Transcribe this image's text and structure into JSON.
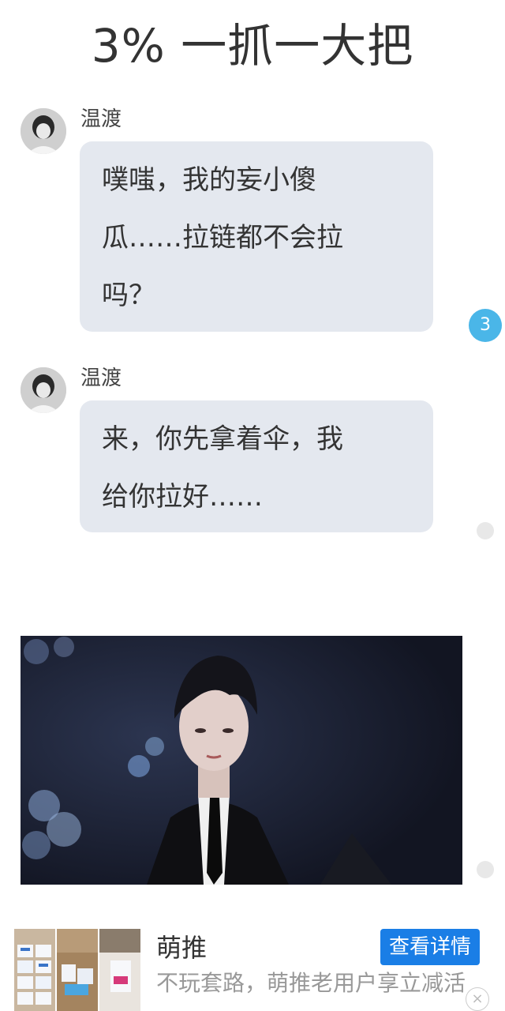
{
  "header": {
    "title": "3% 一抓一大把"
  },
  "messages": [
    {
      "sender": "温渡",
      "text": "噗嗤，我的妄小傻\n瓜……拉链都不会拉\n吗？",
      "comment_count": "3"
    },
    {
      "sender": "温渡",
      "text": "来，你先拿着伞，我\n给你拉好……"
    }
  ],
  "ad": {
    "name": "萌推",
    "description": "不玩套路，萌推老用户享立减活",
    "button_label": "查看详情",
    "close_glyph": "×"
  },
  "colors": {
    "bubble": "#e4e8ef",
    "badge": "#4ab6e8",
    "ad_button": "#1a7ee6"
  }
}
